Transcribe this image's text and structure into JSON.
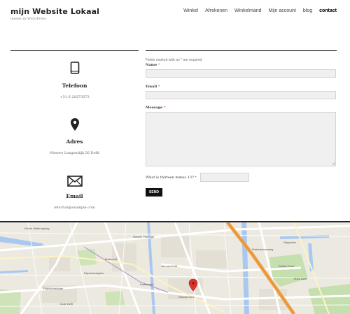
{
  "header": {
    "site_title": "mijn Website Lokaal",
    "tagline": "lessen in WordPress",
    "nav": [
      "Winkel",
      "Afrekenen",
      "Winkelmand",
      "Mijn account",
      "blog",
      "contact"
    ],
    "active_nav": "contact"
  },
  "contact_info": {
    "phone": {
      "title": "Telefoon",
      "value": "+31 6 20273573"
    },
    "address": {
      "title": "Adres",
      "value": "Nieuwe Langendijk 56 Delft"
    },
    "email": {
      "title": "Email",
      "value": "letschat@example.com"
    }
  },
  "form": {
    "required_note": "Fields marked with an * are required",
    "name_label": "Name",
    "email_label": "Email",
    "message_label": "Message",
    "required_marker": "*",
    "captcha_label": "What is thirteen minus 13?",
    "send_label": "SEND"
  },
  "map": {
    "street_labels": [
      "Kleine Wateringweg",
      "Nieuwe Plantage",
      "Rotterdamseweg",
      "Nieuwe Kerk",
      "Papsouwselaan",
      "Delftse Hout",
      "Kaasmarkt",
      "Hof van Delft",
      "Buitenhof",
      "Wippolder",
      "IKEA Delft",
      "Oude Delft",
      "Nijverheidsplein"
    ],
    "marker_color": "#d9342b",
    "highway_color": "#f0a045"
  }
}
